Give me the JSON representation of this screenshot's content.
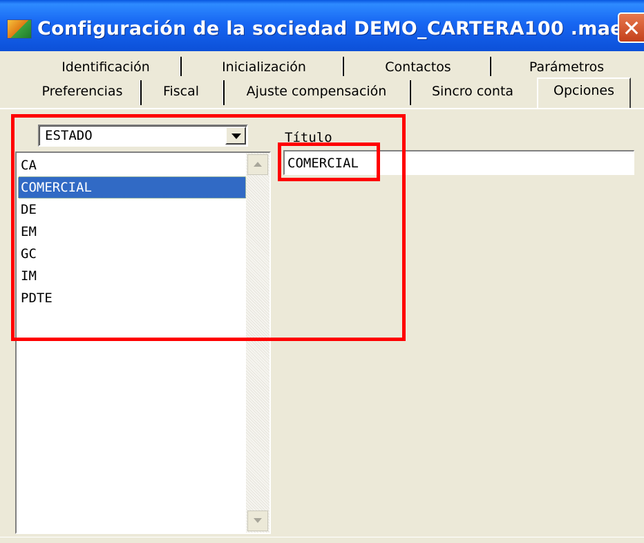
{
  "window": {
    "title": "Configuración de la sociedad DEMO_CARTERA100 .mae",
    "close_glyph": "✕"
  },
  "tabs": {
    "row1": [
      "Identificación",
      "Inicialización",
      "Contactos",
      "Parámetros"
    ],
    "row2": [
      "Preferencias",
      "Fiscal",
      "Ajuste compensación",
      "Sincro conta",
      "Opciones"
    ],
    "active": "Opciones"
  },
  "options": {
    "combo_value": "ESTADO",
    "list_items": [
      "CA",
      "COMERCIAL",
      "DE",
      "EM",
      "GC",
      "IM",
      "PDTE"
    ],
    "selected_item": "COMERCIAL",
    "titulo_label": "Título",
    "titulo_value": "COMERCIAL"
  },
  "colors": {
    "highlight": "#ff0000",
    "selection": "#316ac5",
    "titlebar": "#1766f2"
  }
}
